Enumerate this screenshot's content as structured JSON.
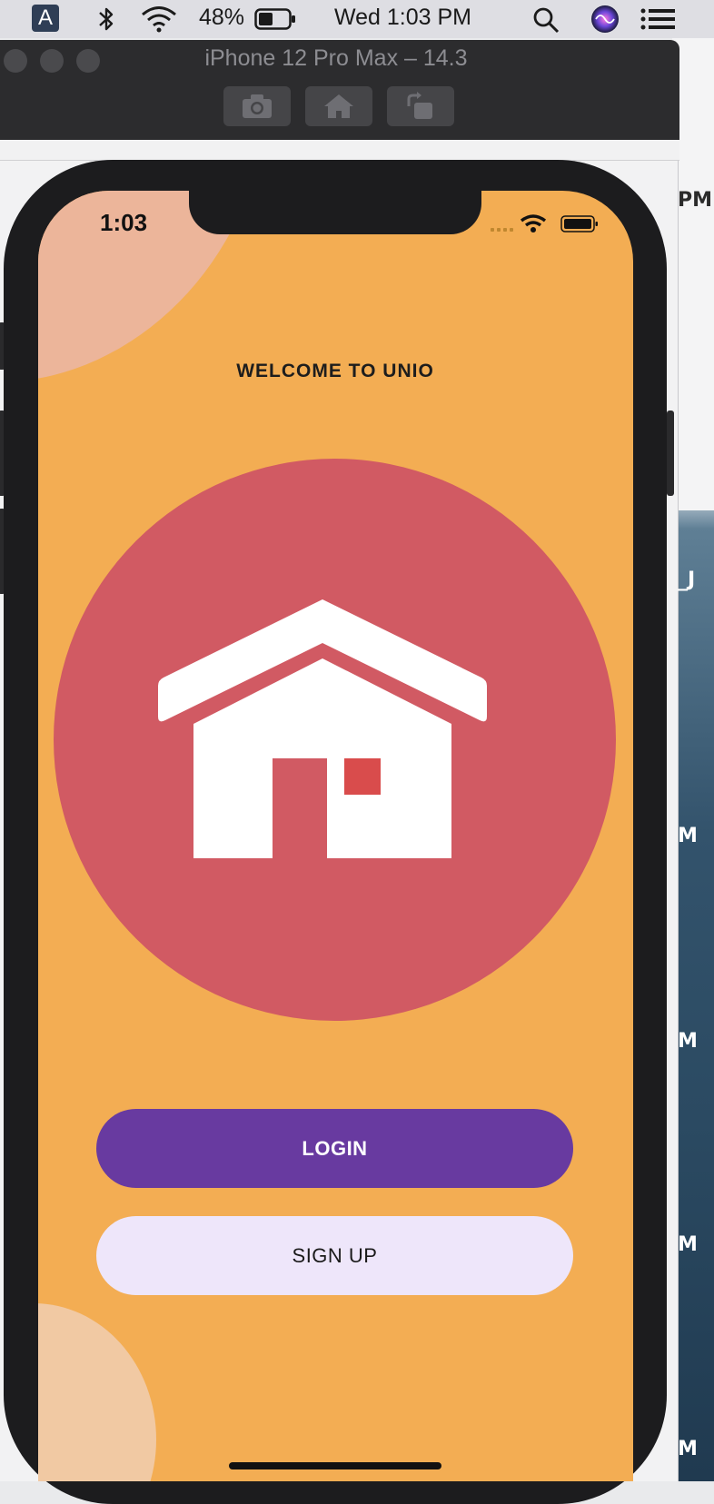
{
  "menubar": {
    "input_source": "A",
    "battery_percent": "48%",
    "datetime": "Wed 1:03 PM"
  },
  "simulator": {
    "title": "iPhone 12 Pro Max – 14.3"
  },
  "background_labels": [
    "PM",
    "_J",
    "M",
    "M",
    "M",
    "M"
  ],
  "phone": {
    "status_time": "1:03",
    "welcome_title": "WELCOME TO UNIO",
    "login_label": "LOGIN",
    "signup_label": "SIGN UP"
  },
  "colors": {
    "screen_bg": "#f3ad53",
    "logo_circle": "#d15a63",
    "login_button": "#683aa0",
    "signup_button": "#eee6fa"
  }
}
